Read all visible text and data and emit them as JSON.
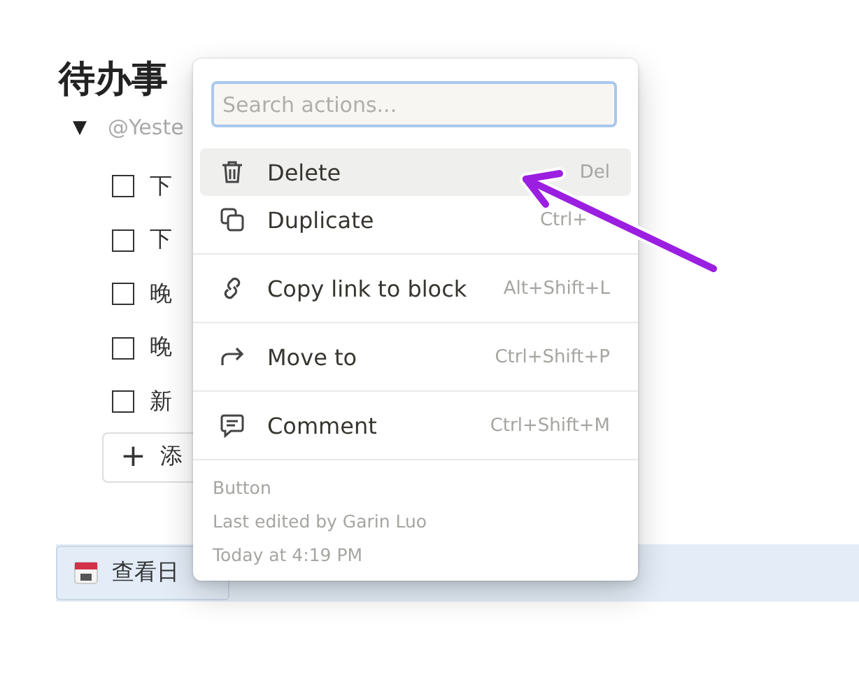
{
  "page": {
    "title": "待办事",
    "group": {
      "toggle": "▼",
      "label": "@Yeste",
      "expanded": true
    },
    "todos": [
      {
        "text": "下",
        "checked": false
      },
      {
        "text": "下",
        "checked": false
      },
      {
        "text": "晚",
        "checked": false
      },
      {
        "text": "晚",
        "checked": false
      },
      {
        "text": "新",
        "checked": false
      }
    ],
    "add_button": {
      "icon": "+",
      "label": "添"
    },
    "calendar_button": {
      "label": "查看日"
    }
  },
  "menu": {
    "search": {
      "placeholder": "Search actions..."
    },
    "sections": [
      [
        {
          "label": "Delete",
          "shortcut": "Del",
          "selected": true
        },
        {
          "label": "Duplicate",
          "shortcut": "Ctrl+",
          "selected": false
        }
      ],
      [
        {
          "label": "Copy link to block",
          "shortcut": "Alt+Shift+L",
          "selected": false
        }
      ],
      [
        {
          "label": "Move to",
          "shortcut": "Ctrl+Shift+P",
          "selected": false
        }
      ],
      [
        {
          "label": "Comment",
          "shortcut": "Ctrl+Shift+M",
          "selected": false
        }
      ]
    ],
    "footer": [
      "Button",
      "Last edited by Garin Luo",
      "Today at 4:19 PM"
    ]
  }
}
